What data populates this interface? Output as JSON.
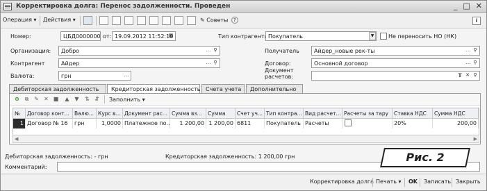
{
  "window": {
    "title": "Корректировка долга: Перенос задолженности. Проведен"
  },
  "toolbar": {
    "operation_label": "Операция",
    "actions_label": "Действия",
    "tips_label": "Советы"
  },
  "header": {
    "number_label": "Номер:",
    "number_value": "ЦБД00000002",
    "from_label": "от:",
    "date_value": "19.09.2012 11:52:10",
    "contractor_type_label": "Тип контрагента:",
    "contractor_type_value": "Покупатель",
    "no_transfer_label": "Не переносить НО (НК)",
    "organization_label": "Организация:",
    "organization_value": "Добро",
    "recipient_label": "Получатель",
    "recipient_value": "Айдер_новые рек-ты",
    "contractor_label": "Контрагент",
    "contractor_value": "Айдер",
    "contract_label": "Договор:",
    "contract_value": "Основной договор",
    "currency_label": "Валюта:",
    "currency_value": "грн",
    "settlement_doc_label_1": "Документ",
    "settlement_doc_label_2": "расчетов:"
  },
  "tabs": [
    {
      "label": "Дебиторская задолженность"
    },
    {
      "label": "Кредиторская задолженность"
    },
    {
      "label": "Счета учета"
    },
    {
      "label": "Дополнительно"
    }
  ],
  "panel": {
    "fill_label": "Заполнить"
  },
  "table": {
    "columns": [
      "№",
      "Договор конт...",
      "Валю...",
      "Курс в...",
      "Документ рас...",
      "Сумма вз...",
      "Сумма",
      "Счет уч...",
      "Тип контра...",
      "Вид расчет...",
      "Расчеты за тару",
      "Ставка НДС",
      "Сумма НДС"
    ],
    "rows": [
      [
        "1",
        "Договор № 16",
        "грн",
        "1,0000",
        "Платежное по...",
        "1 200,00",
        "1 200,00",
        "6811",
        "Покупатель",
        "Расчеты",
        "",
        "20%",
        "200,00"
      ]
    ]
  },
  "footer": {
    "debit_summary": "Дебиторская задолженность: - грн",
    "credit_summary": "Кредиторская задолженность: 1 200,00 грн",
    "comment_label": "Комментарий:",
    "figure_label": "Рис. 2"
  },
  "bottombar": {
    "doc_type": "Корректировка долга",
    "print": "Печать",
    "ok": "OK",
    "save": "Записать",
    "close": "Закрыть"
  }
}
